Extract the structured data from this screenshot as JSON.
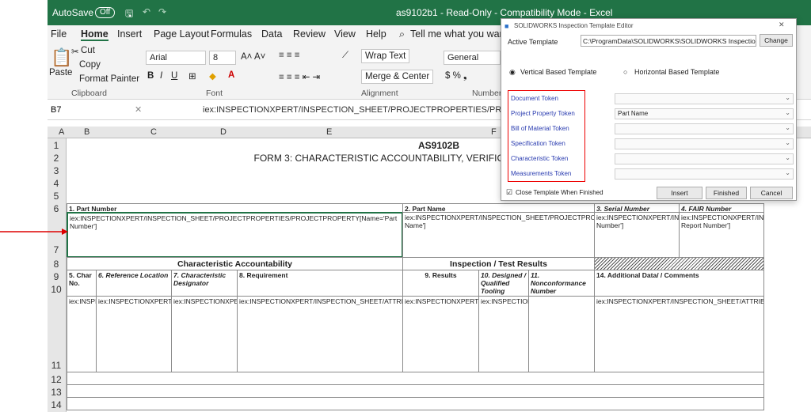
{
  "titlebar": {
    "autosave": "AutoSave",
    "toggle": "Off",
    "title": "as9102b1  -  Read-Only  -  Compatibility Mode  -  Excel"
  },
  "menu": [
    "File",
    "Home",
    "Insert",
    "Page Layout",
    "Formulas",
    "Data",
    "Review",
    "View",
    "Help",
    "Tell me what you want"
  ],
  "ribbon": {
    "cut": "Cut",
    "copy": "Copy",
    "paste": "Paste",
    "format_painter": "Format Painter",
    "font": "Arial",
    "size": "8",
    "wrap": "Wrap Text",
    "merge": "Merge & Center",
    "number_format": "General",
    "groups": [
      "Clipboard",
      "Font",
      "Alignment",
      "Number"
    ]
  },
  "formula": {
    "cell": "B7",
    "text": "iex:INSPECTIONXPERT/INSPECTION_SHEET/PROJECTPROPERTIES/PROJECTPROPERTY[Name='Part N"
  },
  "columns": [
    "A",
    "B",
    "C",
    "D",
    "E",
    "F"
  ],
  "rows": [
    "1",
    "2",
    "3",
    "4",
    "5",
    "6",
    "7",
    "8",
    "9",
    "10",
    "11",
    "12",
    "13",
    "14"
  ],
  "sheet": {
    "title1": "AS9102B",
    "title2": "FORM 3: CHARACTERISTIC ACCOUNTABILITY, VERIFICATION, AND COMPATIE",
    "part_number_label": "1. Part Number",
    "part_number_value": "iex:INSPECTIONXPERT/INSPECTION_SHEET/PROJECTPROPERTIES/PROJECTPROPERTY[Name='Part Number']",
    "part_name_label": "2. Part Name",
    "part_name_value": "iex:INSPECTIONXPERT/INSPECTION_SHEET/PROJECTPROPERTIES/PROJECTPROPERTY[Name='Part Name']",
    "serial_label": "3. Serial Number",
    "serial_value": "iex:INSPECTIONXPERT/INSPECTION_SHEET/PROJECTPROPERTIES/PROJECTPROPERTY[Name='Serial Number']",
    "fai_label": "4. FAIR Number",
    "fai_value": "iex:INSPECTIONXPERT/INSPECTION_SHEET/PROJECTPROPERTIES/PROJECTPROPERTY[Name='FAI Report Number']",
    "char_accountability": "Characteristic Accountability",
    "inspection_results": "Inspection / Test Results",
    "h5": "5. Char No.",
    "h6": "6. Reference Location",
    "h7": "7. Characteristic Designator",
    "h8": "8. Requirement",
    "h9": "9. Results",
    "h10": "10. Designed / Qualified Tooling",
    "h11": "11. Nonconformance Number",
    "h14": "14. Additional Data/ / Comments",
    "v5": "iex:INSPECTIONXPERT/INSPECTION_SHEET/ATTRIBUTES/ATTRIBUTE/@Uid",
    "v6": "iex:INSPECTIONXPERT/INSPECTION_SHEET/ATTRIBUTES/ATTRIBUTE/@FullLocation",
    "v7": "iex:INSPECTIONXPERT/INSPECTION_SHEET/ATTRIBUTES/ATTRIBUTE/@Classification",
    "v8": "iex:INSPECTIONXPERT/INSPECTION_SHEET/ATTRIBUTES/ATTRIBUTE/@Requirement",
    "v9": "iex:INSPECTIONXPERT/INSPECTION_SHEET/ATTRIBUTES/ATTRIBUTE/Measurements/Measurement/@Value",
    "v10": "iex:INSPECTIONXPERT/INSPECTION_SHEET/ATTRIBUTES/ATTRIBUTE/@Process",
    "v14": "iex:INSPECTIONXPERT/INSPECTION_SHEET/ATTRIBUTES/ATTRIBUTE/@Comments"
  },
  "dialog": {
    "title": "SOLIDWORKS Inspection Template Editor",
    "active_label": "Active Template",
    "active_value": "C:\\ProgramData\\SOLIDWORKS\\SOLIDWORKS Inspection",
    "change": "Change",
    "vertical": "Vertical Based Template",
    "horizontal": "Horizontal Based Template",
    "tokens": [
      "Document Token",
      "Project Property Token",
      "Bill of Material Token",
      "Specification Token",
      "Characteristic Token",
      "Measurements Token"
    ],
    "project_property_value": "Part Name",
    "close_label": "Close Template When Finished",
    "insert": "Insert",
    "finished": "Finished",
    "cancel": "Cancel"
  }
}
